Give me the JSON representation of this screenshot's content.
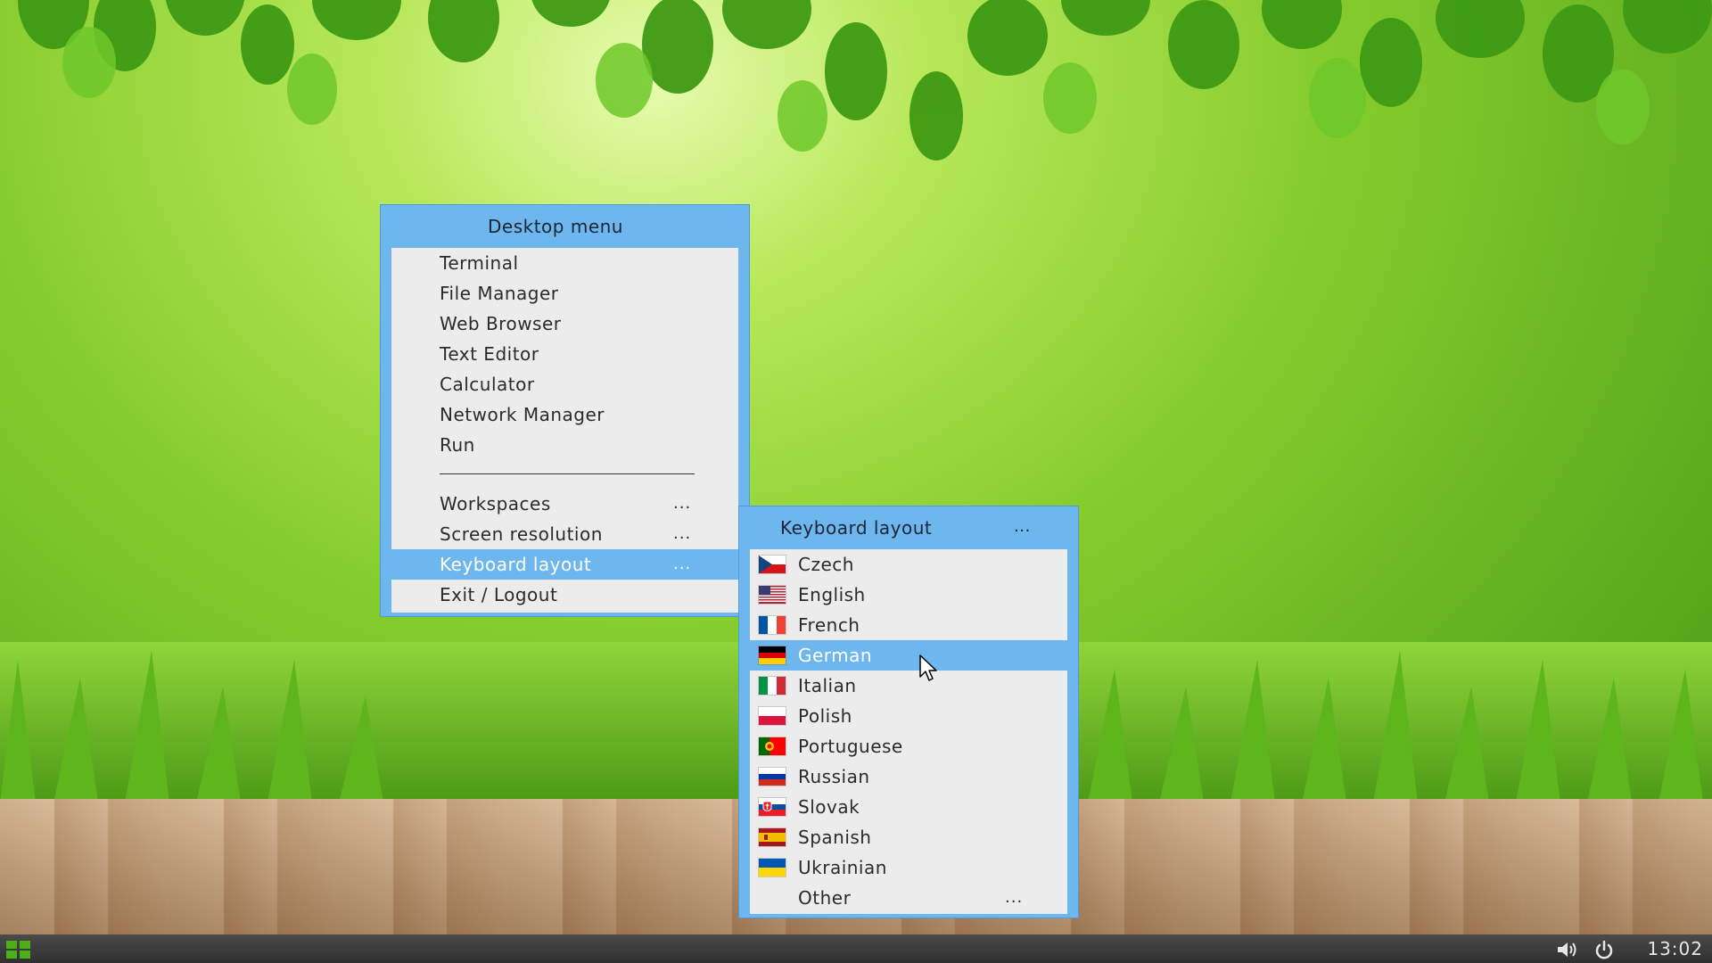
{
  "desktop_menu": {
    "title": "Desktop menu",
    "items": [
      {
        "label": "Terminal"
      },
      {
        "label": "File Manager"
      },
      {
        "label": "Web Browser"
      },
      {
        "label": "Text Editor"
      },
      {
        "label": "Calculator"
      },
      {
        "label": "Network Manager"
      },
      {
        "label": "Run"
      }
    ],
    "sub_items": [
      {
        "label": "Workspaces",
        "more": "..."
      },
      {
        "label": "Screen resolution",
        "more": "..."
      },
      {
        "label": "Keyboard layout",
        "more": "...",
        "selected": true
      },
      {
        "label": "Exit / Logout"
      }
    ]
  },
  "keyboard_menu": {
    "title": "Keyboard layout",
    "title_more": "...",
    "items": [
      {
        "label": "Czech",
        "flag": "czech-flag-icon"
      },
      {
        "label": "English",
        "flag": "us-flag-icon"
      },
      {
        "label": "French",
        "flag": "french-flag-icon"
      },
      {
        "label": "German",
        "flag": "german-flag-icon",
        "selected": true
      },
      {
        "label": "Italian",
        "flag": "italian-flag-icon"
      },
      {
        "label": "Polish",
        "flag": "polish-flag-icon"
      },
      {
        "label": "Portuguese",
        "flag": "portuguese-flag-icon"
      },
      {
        "label": "Russian",
        "flag": "russian-flag-icon"
      },
      {
        "label": "Slovak",
        "flag": "slovak-flag-icon"
      },
      {
        "label": "Spanish",
        "flag": "spanish-flag-icon"
      },
      {
        "label": "Ukrainian",
        "flag": "ukrainian-flag-icon"
      },
      {
        "label": "Other",
        "more": "..."
      }
    ]
  },
  "taskbar": {
    "start_icon": "grid-menu-icon",
    "volume_icon": "volume-icon",
    "power_icon": "power-icon",
    "clock": "13:02"
  },
  "colors": {
    "menu_accent": "#6eb6ee",
    "menu_background": "#ececec",
    "taskbar": "#3a3a3a"
  }
}
